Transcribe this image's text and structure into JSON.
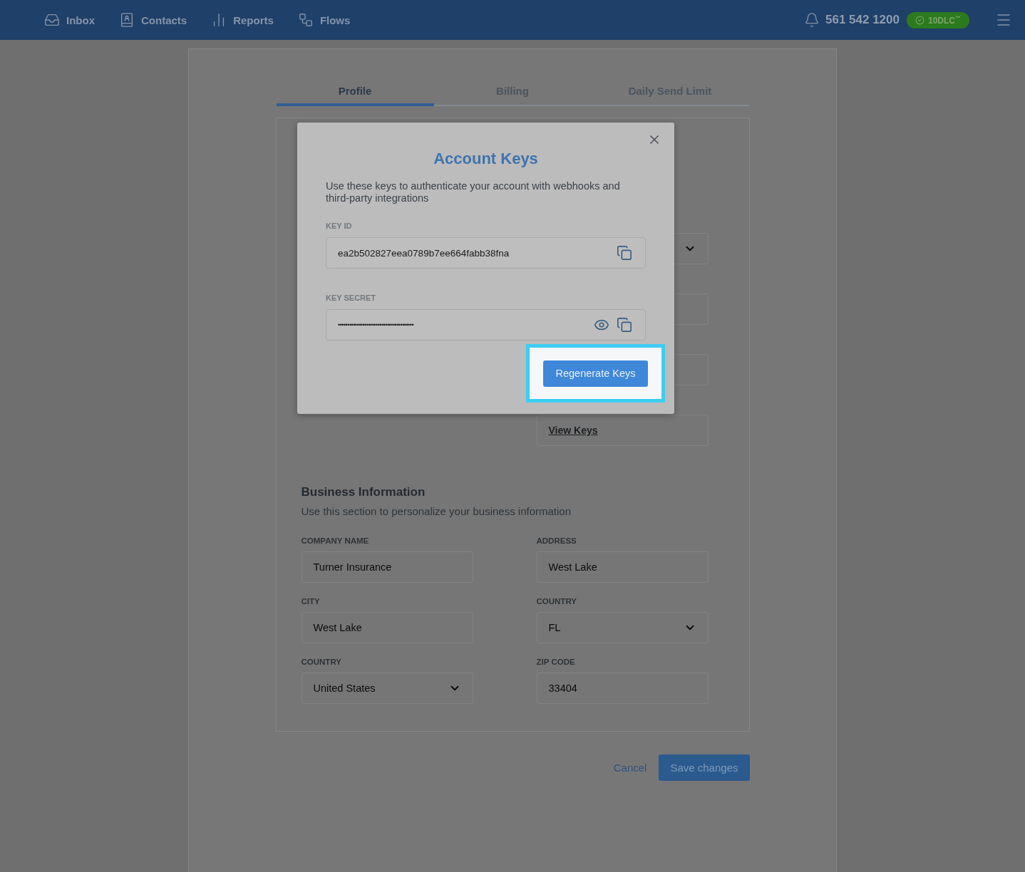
{
  "nav": {
    "items": [
      {
        "kind": "inbox",
        "label": "Inbox"
      },
      {
        "kind": "contacts",
        "label": "Contacts"
      },
      {
        "kind": "reports",
        "label": "Reports"
      },
      {
        "kind": "flows",
        "label": "Flows"
      }
    ],
    "phone": "561 542 1200",
    "badge": "10DLC$^{™}$"
  },
  "tabs": [
    {
      "label": "Profile",
      "selected": true
    },
    {
      "label": "Billing",
      "selected": false
    },
    {
      "label": "Daily Send Limit",
      "selected": false
    }
  ],
  "account_fields": [
    {
      "kind": "select"
    },
    {
      "kind": "text"
    },
    {
      "kind": "text"
    },
    {
      "kind": "link",
      "value": "View Keys"
    }
  ],
  "business": {
    "title": "Business Information",
    "subtitle": "Use this section to personalize your business information",
    "fields": [
      {
        "label": "COMPANY NAME",
        "value": "Turner Insurance",
        "kind": "text"
      },
      {
        "label": "ADDRESS",
        "value": "West Lake",
        "kind": "text"
      },
      {
        "label": "CITY",
        "value": "West Lake",
        "kind": "text"
      },
      {
        "label": "COUNTRY",
        "value": "FL",
        "kind": "select"
      },
      {
        "label": "COUNTRY",
        "value": "United States",
        "kind": "select"
      },
      {
        "label": "ZIP CODE",
        "value": "33404",
        "kind": "text"
      }
    ]
  },
  "actions": {
    "cancel": "Cancel",
    "save": "Save changes"
  },
  "modal": {
    "title": "Account Keys",
    "description": "Use these keys to authenticate your account with webhooks and third-party integrations",
    "fields": [
      {
        "label": "KEY ID",
        "value": "ea2b502827eea0789b7ee664fabb38fna",
        "kind": "id"
      },
      {
        "label": "KEY SECRET",
        "value": "••••••••••••••••••••••••••••••••••••••••",
        "kind": "secret"
      }
    ],
    "button": "Regenerate Keys",
    "highlighted": true
  }
}
